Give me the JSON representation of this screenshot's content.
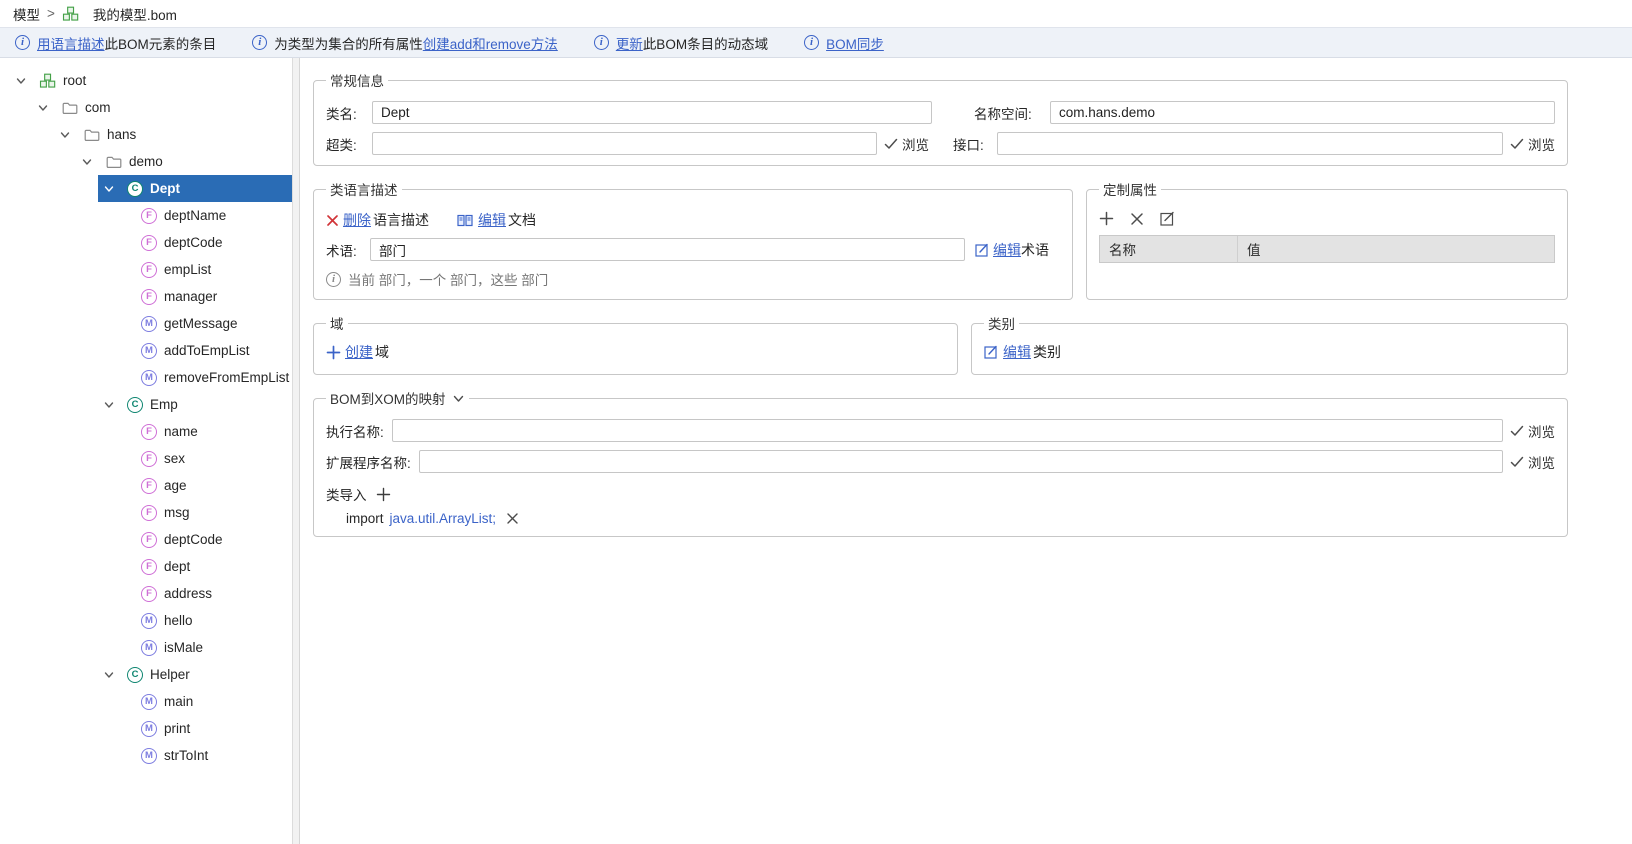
{
  "colors": {
    "link": "#3b63c8",
    "selected_row": "#2a6cb5",
    "class_icon": "#0e8570",
    "field_icon": "#cf6fd6",
    "method_icon": "#7d7de0",
    "root_icon": "#43a047",
    "delete_red": "#d13438",
    "infobar_bg": "#eef2f8"
  },
  "breadcrumb": {
    "root": "模型",
    "separator": ">",
    "file": "我的模型.bom"
  },
  "infobar": {
    "info_glyph": "i",
    "items": [
      {
        "parts": [
          {
            "t": "用语言描述",
            "link": true
          },
          {
            "t": "此BOM元素的条目"
          }
        ]
      },
      {
        "parts": [
          {
            "t": "为类型为集合的所有属性"
          },
          {
            "t": "创建add和remove方法",
            "link": true
          }
        ]
      },
      {
        "parts": [
          {
            "t": "更新",
            "link": true
          },
          {
            "t": "此BOM条目的动态域"
          }
        ]
      },
      {
        "parts": [
          {
            "t": "BOM同步",
            "link": true
          }
        ]
      }
    ]
  },
  "tree": {
    "icon_letters": {
      "class": "C",
      "field": "F",
      "method": "M"
    },
    "nodes": [
      {
        "label": "root",
        "type": "root",
        "level": 0,
        "expandable": true
      },
      {
        "label": "com",
        "type": "folder",
        "level": 1,
        "expandable": true
      },
      {
        "label": "hans",
        "type": "folder",
        "level": 2,
        "expandable": true
      },
      {
        "label": "demo",
        "type": "folder",
        "level": 3,
        "expandable": true
      },
      {
        "label": "Dept",
        "type": "class",
        "level": 4,
        "expandable": true,
        "selected": true
      },
      {
        "label": "deptName",
        "type": "field",
        "level": 5
      },
      {
        "label": "deptCode",
        "type": "field",
        "level": 5
      },
      {
        "label": "empList",
        "type": "field",
        "level": 5
      },
      {
        "label": "manager",
        "type": "field",
        "level": 5
      },
      {
        "label": "getMessage",
        "type": "method",
        "level": 5
      },
      {
        "label": "addToEmpList",
        "type": "method",
        "level": 5
      },
      {
        "label": "removeFromEmpList",
        "type": "method",
        "level": 5
      },
      {
        "label": "Emp",
        "type": "class",
        "level": 4,
        "expandable": true
      },
      {
        "label": "name",
        "type": "field",
        "level": 5
      },
      {
        "label": "sex",
        "type": "field",
        "level": 5
      },
      {
        "label": "age",
        "type": "field",
        "level": 5
      },
      {
        "label": "msg",
        "type": "field",
        "level": 5
      },
      {
        "label": "deptCode",
        "type": "field",
        "level": 5
      },
      {
        "label": "dept",
        "type": "field",
        "level": 5
      },
      {
        "label": "address",
        "type": "field",
        "level": 5
      },
      {
        "label": "hello",
        "type": "method",
        "level": 5
      },
      {
        "label": "isMale",
        "type": "method",
        "level": 5
      },
      {
        "label": "Helper",
        "type": "class",
        "level": 4,
        "expandable": true
      },
      {
        "label": "main",
        "type": "method",
        "level": 5
      },
      {
        "label": "print",
        "type": "method",
        "level": 5
      },
      {
        "label": "strToInt",
        "type": "method",
        "level": 5
      }
    ]
  },
  "general": {
    "legend": "常规信息",
    "class_name_label": "类名:",
    "class_name_value": "Dept",
    "namespace_label": "名称空间:",
    "namespace_value": "com.hans.demo",
    "superclass_label": "超类:",
    "superclass_value": "",
    "interface_label": "接口:",
    "interface_value": "",
    "browse_label": "浏览"
  },
  "verbalization": {
    "legend": "类语言描述",
    "delete_link": "删除",
    "delete_rest": "语言描述",
    "edit_doc_link": "编辑",
    "edit_doc_rest": "文档",
    "term_label": "术语:",
    "term_value": "部门",
    "edit_term_link": "编辑",
    "edit_term_rest": "术语",
    "hint": "当前 部门，一个 部门，这些 部门"
  },
  "custom_props": {
    "legend": "定制属性",
    "col_name": "名称",
    "col_value": "值"
  },
  "domain": {
    "legend": "域",
    "create_link": "创建",
    "create_rest": "域"
  },
  "categories": {
    "legend": "类别",
    "edit_link": "编辑",
    "edit_rest": "类别"
  },
  "b2x": {
    "legend": "BOM到XOM的映射",
    "exec_label": "执行名称:",
    "exec_value": "",
    "executor_label": "扩展程序名称:",
    "executor_value": "",
    "browse_label": "浏览",
    "imports_label": "类导入",
    "import_keyword": "import",
    "import_class": "java.util.ArrayList;"
  }
}
